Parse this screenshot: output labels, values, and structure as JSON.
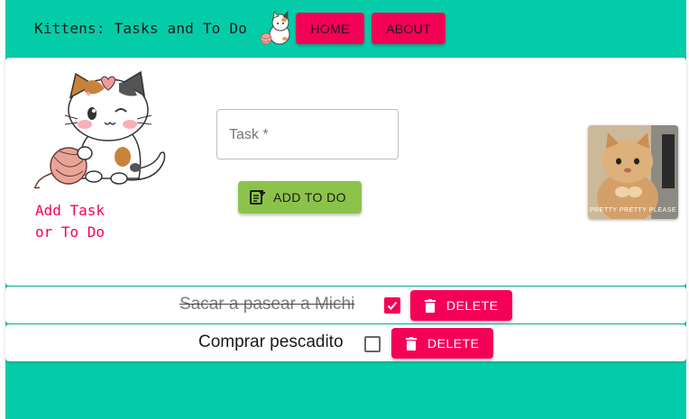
{
  "header": {
    "title": "Kittens: Tasks and To Do",
    "nav": {
      "home_label": "HOME",
      "about_label": "ABOUT"
    }
  },
  "add_card": {
    "caption": "Add Task or To Do",
    "task_field": {
      "label": "Task *",
      "value": ""
    },
    "add_button_label": "ADD TO DO",
    "photo_caption": "PRETTY PRETTY PLEASE"
  },
  "tasks": [
    {
      "text": "Sacar a pasear a Michi",
      "done": true,
      "delete_label": "DELETE"
    },
    {
      "text": "Comprar pescadito",
      "done": false,
      "delete_label": "DELETE"
    }
  ],
  "colors": {
    "background": "#05cca8",
    "accent": "#f50057",
    "add_button": "#8bc34a"
  },
  "icons": [
    "cat-logo-icon",
    "note-add-icon",
    "delete-icon",
    "checkbox-icon"
  ]
}
